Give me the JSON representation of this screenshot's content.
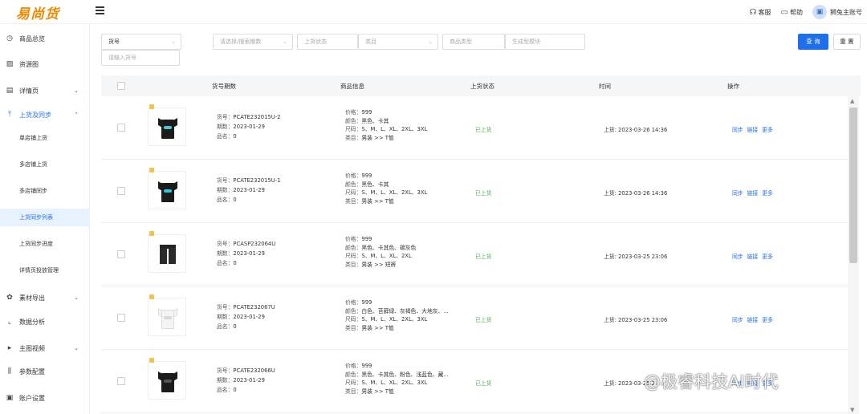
{
  "app": {
    "logo": "易尚货"
  },
  "header": {
    "service_label": "客服",
    "help_label": "帮助",
    "account_label": "狮兔主账号"
  },
  "sidebar": {
    "items": [
      {
        "label": "商品总览",
        "icon": "clock-icon"
      },
      {
        "label": "资源图",
        "icon": "image-icon"
      },
      {
        "label": "详情页",
        "icon": "document-icon"
      },
      {
        "label": "上货及同步",
        "icon": "upload-icon"
      },
      {
        "label": "单店铺上货"
      },
      {
        "label": "多店铺上货"
      },
      {
        "label": "多店铺同步"
      },
      {
        "label": "上货同步列表"
      },
      {
        "label": "上货同步进度"
      },
      {
        "label": "详情页投放管理"
      },
      {
        "label": "素材导出",
        "icon": "palette-icon"
      },
      {
        "label": "数据分析",
        "icon": "chart-icon"
      },
      {
        "label": "主图视频",
        "icon": "video-icon"
      },
      {
        "label": "参数配置",
        "icon": "settings-icon"
      },
      {
        "label": "账户设置",
        "icon": "account-icon"
      }
    ]
  },
  "filters": {
    "type_select": "货号",
    "code_placeholder": "请输入货号",
    "period_placeholder": "请选择/搜索期数",
    "status_placeholder": "上货状态",
    "category_placeholder": "类目",
    "product_type_placeholder": "商品类型",
    "template_placeholder": "生成型模块",
    "query_label": "查 询",
    "reset_label": "重 置"
  },
  "table": {
    "headers": [
      "货号期数",
      "商品信息",
      "上货状态",
      "时间",
      "操作"
    ],
    "labels": {
      "code": "货号：",
      "period": "期数：",
      "name": "品名：",
      "price": "价格：",
      "color": "颜色：",
      "size": "尺码：",
      "category": "类目："
    },
    "rows": [
      {
        "code": "PCATE232015U-2",
        "period": "2023-01-29",
        "name": "0",
        "price": "999",
        "color": "黑色、卡其",
        "size": "S、M、L、XL、2XL、3XL",
        "category": "男装 >> T恤",
        "status": "已上货",
        "time": "上货: 2023-03-26 14:36",
        "shirt": "black",
        "print": "#4fc3d8"
      },
      {
        "code": "PCATE232015U-1",
        "period": "2023-01-29",
        "name": "0",
        "price": "999",
        "color": "黑色、卡其",
        "size": "S、M、L、XL、2XL、3XL",
        "category": "男装 >> T恤",
        "status": "已上货",
        "time": "上货: 2023-03-26 14:36",
        "shirt": "black",
        "print": "#2ec8d8"
      },
      {
        "code": "PCASP232064U",
        "period": "2023-01-29",
        "name": "0",
        "price": "999",
        "color": "黑色、卡其色、碳灰色",
        "size": "S、M、L、XL、2XL",
        "category": "男装 >> 短裤",
        "status": "已上货",
        "time": "上货: 2023-03-25 23:06",
        "shirt": "shorts",
        "print": ""
      },
      {
        "code": "PCATE232067U",
        "period": "2023-01-29",
        "name": "0",
        "price": "999",
        "color": "白色、苔藓绿、灰褐色、大地灰、...",
        "size": "S、M、L、XL、2XL、3XL",
        "category": "男装 >> T恤",
        "status": "已上货",
        "time": "上货: 2023-03-25 23:06",
        "shirt": "white",
        "print": "#d8d8d8"
      },
      {
        "code": "PCATE232066U",
        "period": "2023-01-29",
        "name": "0",
        "price": "999",
        "color": "黑色、卡其色、粉色、浅蓝色、藏...",
        "size": "S、M、L、XL、2XL、3XL",
        "category": "男装 >> T恤",
        "status": "已上货",
        "time": "上货: 2023-03-25 2",
        "shirt": "black",
        "print": "#555555"
      }
    ],
    "ops": [
      "同步",
      "链接",
      "更多"
    ]
  },
  "watermark": "@极睿科技AI时代"
}
